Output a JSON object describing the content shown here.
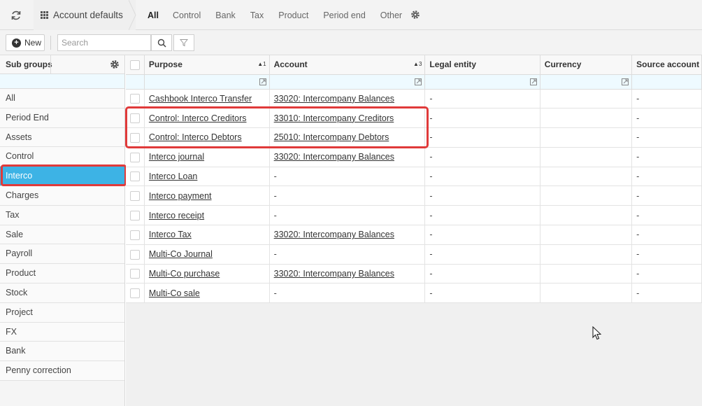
{
  "header": {
    "title": "Account defaults",
    "tabs": [
      "All",
      "Control",
      "Bank",
      "Tax",
      "Product",
      "Period end",
      "Other"
    ],
    "active_tab": "All"
  },
  "toolbar": {
    "new_label": "New",
    "search_placeholder": "Search"
  },
  "sidebar": {
    "title": "Sub groups",
    "items": [
      "All",
      "Period End",
      "Assets",
      "Control",
      "Interco",
      "Charges",
      "Tax",
      "Sale",
      "Payroll",
      "Product",
      "Stock",
      "Project",
      "FX",
      "Bank",
      "Penny correction"
    ],
    "selected": "Interco"
  },
  "grid": {
    "columns": [
      {
        "label": "Purpose",
        "sort": "▲1"
      },
      {
        "label": "Account",
        "sort": "▲3"
      },
      {
        "label": "Legal entity",
        "sort": ""
      },
      {
        "label": "Currency",
        "sort": ""
      },
      {
        "label": "Source account",
        "sort": ""
      }
    ],
    "rows": [
      {
        "purpose": "Cashbook Interco Transfer",
        "account": "33020: Intercompany Balances",
        "legal_entity": "-",
        "currency": "",
        "source": "-"
      },
      {
        "purpose": "Control: Interco Creditors",
        "account": "33010: Intercompany Creditors",
        "legal_entity": "-",
        "currency": "",
        "source": "-"
      },
      {
        "purpose": "Control: Interco Debtors",
        "account": "25010: Intercompany Debtors",
        "legal_entity": "-",
        "currency": "",
        "source": "-"
      },
      {
        "purpose": "Interco journal",
        "account": "33020: Intercompany Balances",
        "legal_entity": "-",
        "currency": "",
        "source": "-"
      },
      {
        "purpose": "Interco Loan",
        "account": "-",
        "legal_entity": "-",
        "currency": "",
        "source": "-"
      },
      {
        "purpose": "Interco payment",
        "account": "-",
        "legal_entity": "-",
        "currency": "",
        "source": "-"
      },
      {
        "purpose": "Interco receipt",
        "account": "-",
        "legal_entity": "-",
        "currency": "",
        "source": "-"
      },
      {
        "purpose": "Interco Tax",
        "account": "33020: Intercompany Balances",
        "legal_entity": "-",
        "currency": "",
        "source": "-"
      },
      {
        "purpose": "Multi-Co Journal",
        "account": "-",
        "legal_entity": "-",
        "currency": "",
        "source": "-"
      },
      {
        "purpose": "Multi-Co purchase",
        "account": "33020: Intercompany Balances",
        "legal_entity": "-",
        "currency": "",
        "source": "-"
      },
      {
        "purpose": "Multi-Co sale",
        "account": "-",
        "legal_entity": "-",
        "currency": "",
        "source": "-"
      }
    ]
  },
  "colors": {
    "selection": "#3db3e5",
    "highlight_ring": "#e03a3a",
    "filter_row": "#eefaff"
  }
}
